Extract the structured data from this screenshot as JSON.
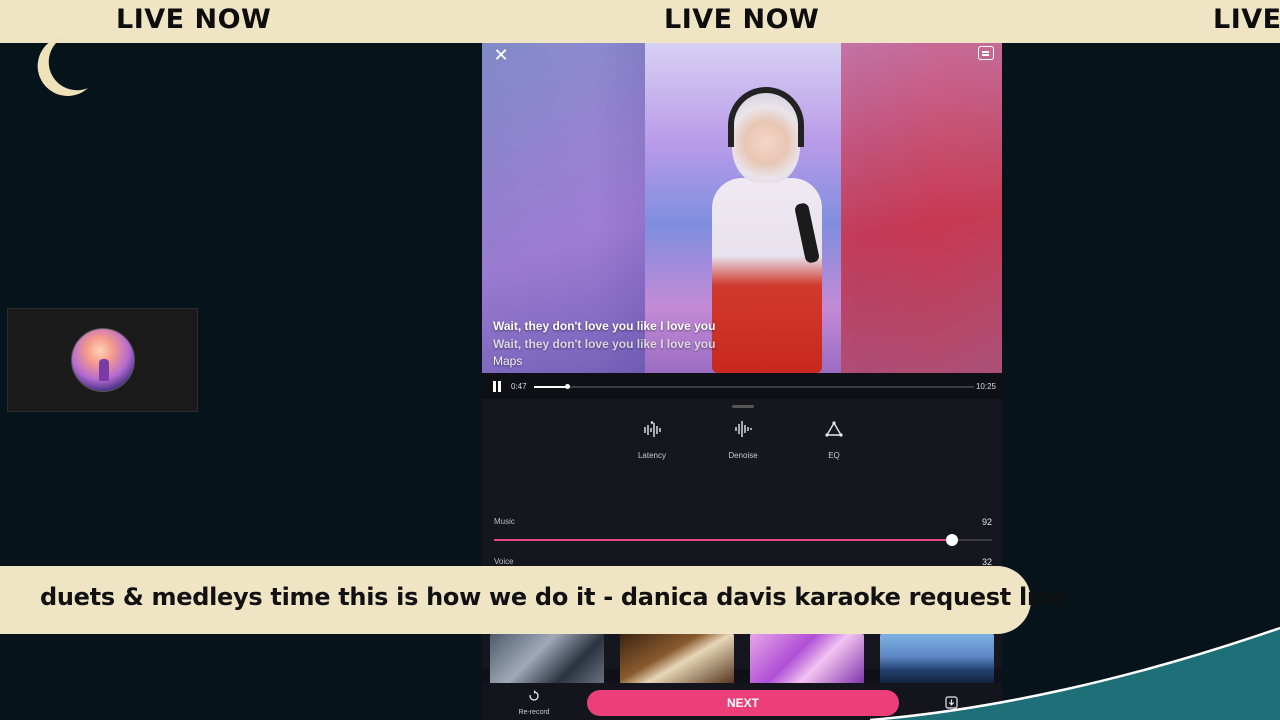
{
  "ticker": {
    "items": [
      "LIVE NOW",
      "LIVE NOW",
      "LIVE"
    ]
  },
  "caption": {
    "text": "duets & medleys time this is how we do it - danica davis karaoke request line"
  },
  "player": {
    "lyrics": [
      "Wait, they don't love you like I love you",
      "Wait, they don't love you like I love you",
      "Maps"
    ],
    "current_time": "0:47",
    "duration": "10:25",
    "progress": 0.076
  },
  "tools": [
    {
      "label": "Latency",
      "icon": "latency-waveform-icon"
    },
    {
      "label": "Denoise",
      "icon": "denoise-waveform-icon"
    },
    {
      "label": "EQ",
      "icon": "eq-triangle-icon"
    }
  ],
  "sliders": {
    "music": {
      "label": "Music",
      "value": "92",
      "level": 0.92
    },
    "voice": {
      "label": "Voice",
      "value": "32",
      "level": 0.32
    }
  },
  "bottom": {
    "rerecord_label": "Re-record",
    "next_label": "NEXT"
  },
  "colors": {
    "banner": "#efe4c4",
    "accent_pink": "#ec3f7a",
    "slider_pink": "#e4487c",
    "background": "#06131b",
    "wave_teal": "#1d6f78"
  }
}
